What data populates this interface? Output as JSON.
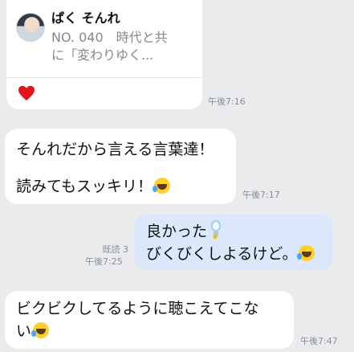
{
  "share_card": {
    "title": "ぱく そんれ",
    "subtitle": "NO. 040　時代と共に「変わりゆく...",
    "like_icon": "heart-icon",
    "time": "午後7:16"
  },
  "messages": [
    {
      "side": "incoming",
      "line1": "そんれだから言える言葉達！",
      "line2": "読みてもスッキリ！",
      "emoji": "laughing-crying-emoji",
      "time": "午後7:17"
    },
    {
      "side": "outgoing",
      "line1": "良かった",
      "line2": "びくびくしよるけど。",
      "read_label": "既読 3",
      "time": "午後7:25"
    },
    {
      "side": "incoming",
      "line1": "ビクビクしてるように聴こえてこな",
      "line2": "い",
      "time": "午後7:47"
    }
  ],
  "colors": {
    "background": "#e9ebed",
    "incoming_bubble": "#ffffff",
    "outgoing_bubble": "#dbe7fb",
    "heart": "#e0161b"
  }
}
